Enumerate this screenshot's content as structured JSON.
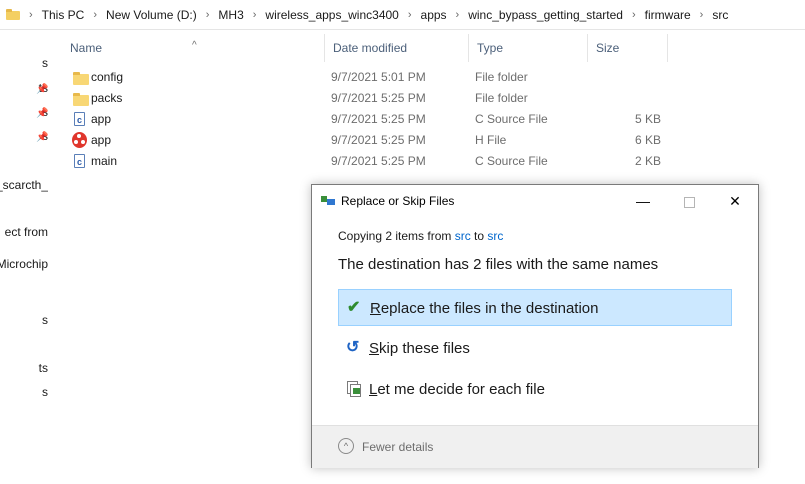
{
  "breadcrumb": [
    "This PC",
    "New Volume (D:)",
    "MH3",
    "wireless_apps_winc3400",
    "apps",
    "winc_bypass_getting_started",
    "firmware",
    "src"
  ],
  "nav": [
    "s",
    "ts",
    "s",
    "s",
    "t_scarcth_",
    "ect from",
    "Microchip",
    "s",
    "ts",
    "s"
  ],
  "columns": {
    "name": "Name",
    "date": "Date modified",
    "type": "Type",
    "size": "Size"
  },
  "files": [
    {
      "icon": "folder-icon",
      "name": "config",
      "date": "9/7/2021 5:01 PM",
      "type": "File folder",
      "size": ""
    },
    {
      "icon": "folder-icon",
      "name": "packs",
      "date": "9/7/2021 5:25 PM",
      "type": "File folder",
      "size": ""
    },
    {
      "icon": "c-source-file-icon",
      "name": "app",
      "date": "9/7/2021 5:25 PM",
      "type": "C Source File",
      "size": "5 KB"
    },
    {
      "icon": "h-file-icon",
      "name": "app",
      "date": "9/7/2021 5:25 PM",
      "type": "H File",
      "size": "6 KB"
    },
    {
      "icon": "c-source-file-icon",
      "name": "main",
      "date": "9/7/2021 5:25 PM",
      "type": "C Source File",
      "size": "2 KB"
    }
  ],
  "dialog": {
    "title": "Replace or Skip Files",
    "copying_prefix": "Copying 2 items from ",
    "from": "src",
    "to_word": " to ",
    "to": "src",
    "headline": "The destination has 2 files with the same names",
    "options": {
      "replace": {
        "key": "R",
        "rest": "eplace the files in the destination"
      },
      "skip": {
        "key": "S",
        "rest": "kip these files"
      },
      "decide": {
        "key": "L",
        "rest": "et me decide for each file"
      }
    },
    "fewer_details": "Fewer details",
    "minimize_glyph": "—",
    "close_glyph": "✕"
  },
  "accent_colors": {
    "selection": "#cce8ff",
    "link": "#0066cc"
  }
}
